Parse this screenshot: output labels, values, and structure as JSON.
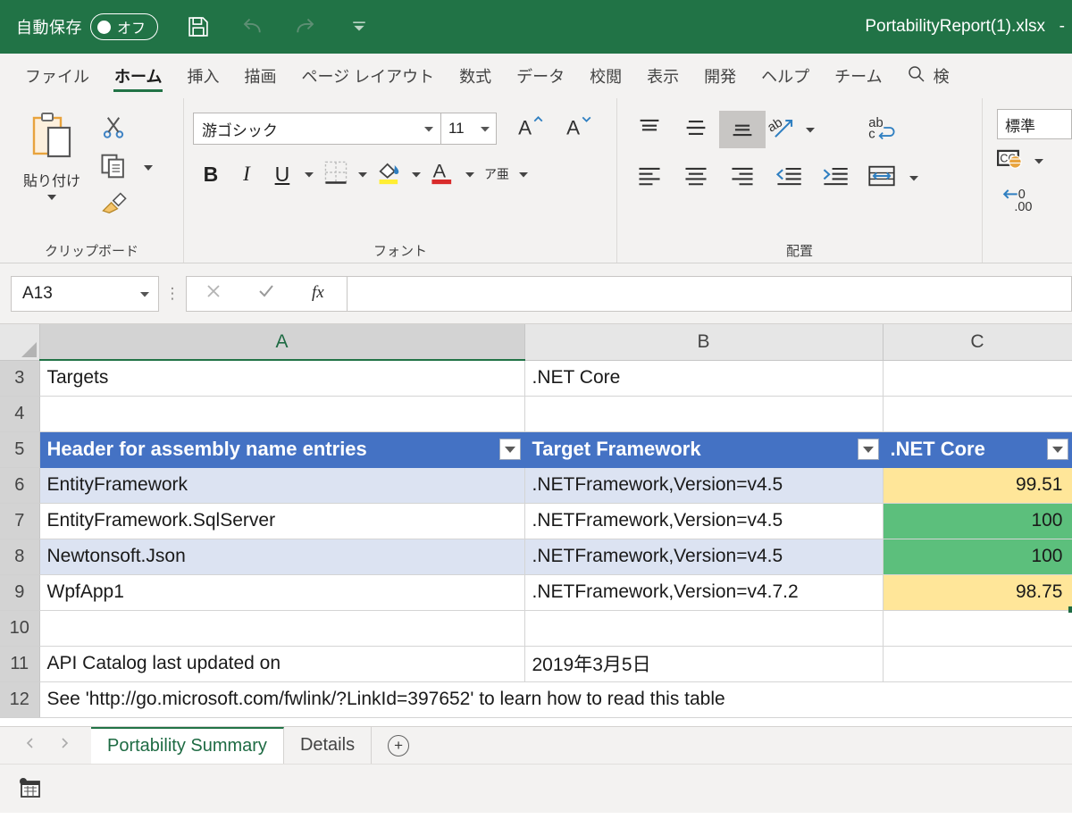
{
  "titlebar": {
    "autosave_label": "自動保存",
    "autosave_state": "オフ",
    "save_icon": "save-icon",
    "undo_icon": "undo-icon",
    "redo_icon": "redo-icon",
    "qat_more_icon": "qat-overflow-icon",
    "document_title": "PortabilityReport(1).xlsx",
    "title_suffix": "-"
  },
  "ribbon_tabs": [
    {
      "label": "ファイル",
      "active": false
    },
    {
      "label": "ホーム",
      "active": true
    },
    {
      "label": "挿入",
      "active": false
    },
    {
      "label": "描画",
      "active": false
    },
    {
      "label": "ページ レイアウト",
      "active": false
    },
    {
      "label": "数式",
      "active": false
    },
    {
      "label": "データ",
      "active": false
    },
    {
      "label": "校閲",
      "active": false
    },
    {
      "label": "表示",
      "active": false
    },
    {
      "label": "開発",
      "active": false
    },
    {
      "label": "ヘルプ",
      "active": false
    },
    {
      "label": "チーム",
      "active": false
    }
  ],
  "ribbon_search": {
    "icon": "search-icon",
    "label": "検"
  },
  "ribbon": {
    "clipboard": {
      "group_label": "クリップボード",
      "paste_label": "貼り付け",
      "paste_icon": "paste-icon",
      "cut_icon": "scissors-icon",
      "copy_icon": "copy-icon",
      "format_painter_icon": "format-painter-icon"
    },
    "font": {
      "group_label": "フォント",
      "font_name": "游ゴシック",
      "font_size": "11",
      "grow_font_icon": "grow-font-icon",
      "shrink_font_icon": "shrink-font-icon",
      "bold_label": "B",
      "italic_label": "I",
      "underline_label": "U",
      "borders_icon": "borders-icon",
      "fill_color_icon": "fill-color-icon",
      "font_color_icon": "font-color-icon",
      "phonetic_label": "ア亜"
    },
    "alignment": {
      "group_label": "配置",
      "align_top_icon": "align-top-icon",
      "align_middle_icon": "align-middle-icon",
      "align_bottom_icon": "align-bottom-icon",
      "orientation_icon": "text-orientation-icon",
      "wrap_text_icon": "wrap-text-icon",
      "align_left_icon": "align-left-icon",
      "align_center_icon": "align-center-icon",
      "align_right_icon": "align-right-icon",
      "decrease_indent_icon": "decrease-indent-icon",
      "increase_indent_icon": "increase-indent-icon",
      "merge_cells_icon": "merge-cells-icon"
    },
    "number": {
      "format_value": "標準",
      "accounting_icon": "accounting-format-icon",
      "decrease_decimal_icon": "decrease-decimal-icon"
    }
  },
  "formula_bar": {
    "name_box_value": "A13",
    "cancel_icon": "cancel-icon",
    "enter_icon": "confirm-icon",
    "function_icon": "insert-function-icon",
    "formula_value": ""
  },
  "grid": {
    "column_headers": [
      {
        "label": "A",
        "selected": true
      },
      {
        "label": "B",
        "selected": false
      },
      {
        "label": "C",
        "selected": false
      }
    ],
    "rows": [
      {
        "number": "3",
        "band": false,
        "cells": [
          {
            "value": "Targets",
            "style": "text"
          },
          {
            "value": ".NET Core",
            "style": "text"
          },
          {
            "value": "",
            "style": "text"
          }
        ]
      },
      {
        "number": "4",
        "band": false,
        "cells": [
          {
            "value": "",
            "style": "text"
          },
          {
            "value": "",
            "style": "text"
          },
          {
            "value": "",
            "style": "text"
          }
        ]
      },
      {
        "number": "5",
        "band": false,
        "header": true,
        "cells": [
          {
            "value": "Header for assembly name entries",
            "style": "header"
          },
          {
            "value": "Target Framework",
            "style": "header"
          },
          {
            "value": ".NET Core",
            "style": "header"
          }
        ]
      },
      {
        "number": "6",
        "band": true,
        "cells": [
          {
            "value": "EntityFramework",
            "style": "text"
          },
          {
            "value": ".NETFramework,Version=v4.5",
            "style": "text"
          },
          {
            "value": "99.51",
            "style": "yellow"
          }
        ]
      },
      {
        "number": "7",
        "band": false,
        "cells": [
          {
            "value": "EntityFramework.SqlServer",
            "style": "text"
          },
          {
            "value": ".NETFramework,Version=v4.5",
            "style": "text"
          },
          {
            "value": "100",
            "style": "green"
          }
        ]
      },
      {
        "number": "8",
        "band": true,
        "cells": [
          {
            "value": "Newtonsoft.Json",
            "style": "text"
          },
          {
            "value": ".NETFramework,Version=v4.5",
            "style": "text"
          },
          {
            "value": "100",
            "style": "green"
          }
        ]
      },
      {
        "number": "9",
        "band": false,
        "cells": [
          {
            "value": "WpfApp1",
            "style": "text"
          },
          {
            "value": ".NETFramework,Version=v4.7.2",
            "style": "text"
          },
          {
            "value": "98.75",
            "style": "yellow"
          }
        ]
      },
      {
        "number": "10",
        "band": false,
        "cells": [
          {
            "value": "",
            "style": "text"
          },
          {
            "value": "",
            "style": "text"
          },
          {
            "value": "",
            "style": "text"
          }
        ]
      },
      {
        "number": "11",
        "band": false,
        "cells": [
          {
            "value": "API Catalog last updated on",
            "style": "text"
          },
          {
            "value": "2019年3月5日",
            "style": "text"
          },
          {
            "value": "",
            "style": "text"
          }
        ]
      },
      {
        "number": "12",
        "band": false,
        "spanned": true,
        "cells": [
          {
            "value": "See 'http://go.microsoft.com/fwlink/?LinkId=397652' to learn how to read this table",
            "style": "text"
          }
        ]
      }
    ]
  },
  "sheet_tabs": {
    "prev_icon": "prev-sheet-icon",
    "next_icon": "next-sheet-icon",
    "tabs": [
      {
        "label": "Portability Summary",
        "active": true
      },
      {
        "label": "Details",
        "active": false
      }
    ],
    "add_label": "+"
  },
  "status_bar": {
    "accessibility_icon": "table-status-icon"
  },
  "colors": {
    "excel_green": "#217346",
    "table_header_blue": "#4472c4",
    "band_blue": "#dce3f2",
    "value_yellow": "#ffe699",
    "value_green": "#5cbf7c"
  }
}
